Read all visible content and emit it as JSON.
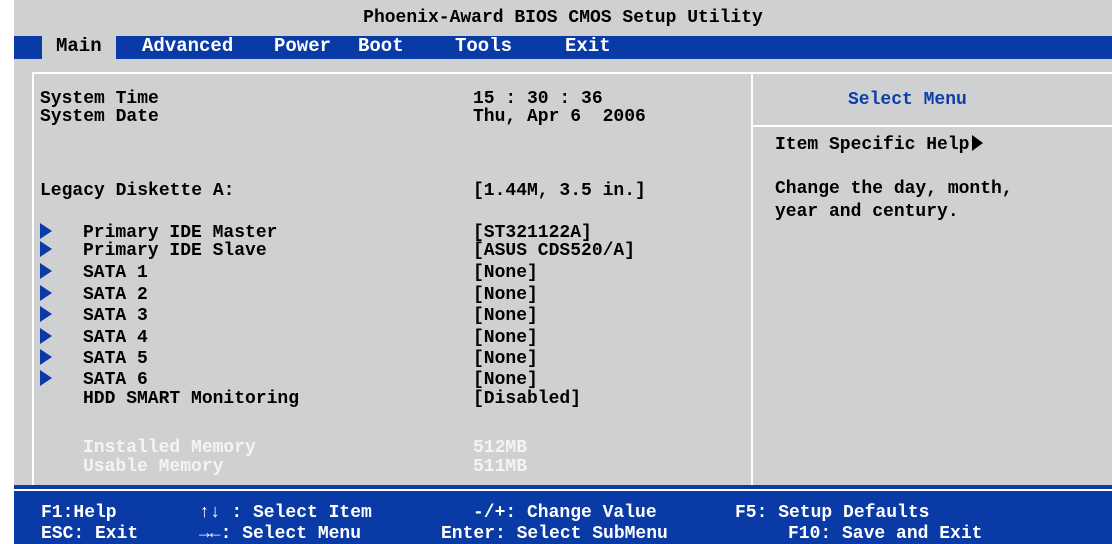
{
  "title": "Phoenix-Award BIOS CMOS Setup Utility",
  "menu": [
    "Main",
    "Advanced",
    "Power",
    "Boot",
    "Tools",
    "Exit"
  ],
  "main": {
    "system_time": {
      "label": "System Time",
      "value": "15 : 30 : 36"
    },
    "system_date": {
      "label": "System Date",
      "value": "Thu, Apr 6  2006"
    },
    "legacy_diskette": {
      "label": "Legacy Diskette A:",
      "value": "[1.44M, 3.5 in.]"
    },
    "submenus": [
      {
        "label": "Primary IDE Master",
        "value": "[ST321122A]"
      },
      {
        "label": "Primary IDE Slave",
        "value": "[ASUS CDS520/A]"
      },
      {
        "label": "SATA 1",
        "value": "[None]"
      },
      {
        "label": "SATA 2",
        "value": "[None]"
      },
      {
        "label": "SATA 3",
        "value": "[None]"
      },
      {
        "label": "SATA 4",
        "value": "[None]"
      },
      {
        "label": "SATA 5",
        "value": "[None]"
      },
      {
        "label": "SATA 6",
        "value": "[None]"
      }
    ],
    "hdd_smart": {
      "label": "HDD SMART Monitoring",
      "value": "[Disabled]"
    },
    "installed_memory": {
      "label": "Installed Memory",
      "value": "512MB"
    },
    "usable_memory": {
      "label": "Usable Memory",
      "value": "511MB"
    }
  },
  "help": {
    "header": "Select Menu",
    "item_specific": "Item Specific Help",
    "text_line1": "Change the day, month,",
    "text_line2": "year and century."
  },
  "status": {
    "f1": "F1:Help",
    "select_item": "↑↓ : Select Item",
    "change_value": "-/+: Change Value",
    "f5": "F5: Setup Defaults",
    "esc": "ESC: Exit",
    "select_menu": "→←: Select Menu",
    "enter": "Enter: Select SubMenu",
    "f10": "F10: Save and Exit"
  },
  "colors": {
    "menu_blue": "#0a3aa6",
    "panel_gray": "#cfd0d2",
    "help_head": "#0b3fa8"
  }
}
